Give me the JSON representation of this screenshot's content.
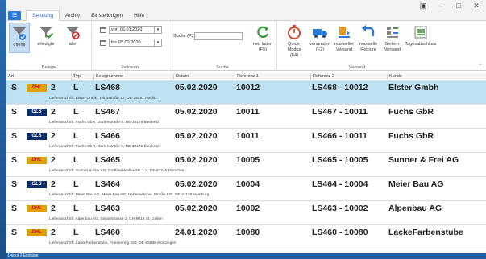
{
  "window": {
    "controls": [
      "▣",
      "–",
      "□",
      "✕"
    ]
  },
  "menu_icon": "☰",
  "tabs": [
    {
      "label": "Sendung",
      "active": true
    },
    {
      "label": "Archiv"
    },
    {
      "label": "Einstellungen"
    },
    {
      "label": "Hilfe"
    }
  ],
  "ribbon": {
    "belege": {
      "label": "Belege",
      "buttons": [
        {
          "label": "offene",
          "icon": "funnel-icon",
          "selected": true
        },
        {
          "label": "erledigte",
          "icon": "funnel-check-icon"
        },
        {
          "label": "alle",
          "icon": "funnel-no-icon"
        }
      ]
    },
    "zeitraum": {
      "label": "Zeitraum",
      "von_label": "von",
      "von_value": "06.01.2020",
      "bis_label": "bis",
      "bis_value": "05.02.2020"
    },
    "suche": {
      "label": "Suche",
      "field_label": "Suche (F3):",
      "value": ""
    },
    "laden": {
      "label_line1": "neu laden",
      "label_line2": "(F5)"
    },
    "versand": {
      "label": "Versand",
      "buttons": [
        {
          "line1": "Quick-Modus",
          "line2": "(F4)",
          "icon": "stopwatch-icon"
        },
        {
          "line1": "versenden",
          "line2": "(F2)",
          "icon": "truck-icon"
        },
        {
          "line1": "manueller",
          "line2": "Versand",
          "icon": "manual-ship-icon"
        },
        {
          "line1": "manuelle",
          "line2": "Retoure",
          "icon": "return-icon"
        },
        {
          "line1": "Seriein-",
          "line2": "Versand",
          "icon": "serial-icon"
        },
        {
          "line1": "Tagesabschluss",
          "line2": "",
          "icon": "day-close-icon"
        }
      ]
    }
  },
  "columns": {
    "art": "Art",
    "typ": "Typ",
    "belegnummer": "Belegnummer",
    "datum": "Datum",
    "ref1": "Referenz 1",
    "ref2": "Referenz 2",
    "kunde": "Kunde"
  },
  "rows": [
    {
      "art": "S",
      "carrier": "DHL",
      "qty": "2",
      "typ": "L",
      "beleg": "LS468",
      "datum": "05.02.2020",
      "ref1": "10012",
      "ref2": "LS468 - 10012",
      "kunde": "Elster Gmbh",
      "anschrift": "Lieferanschrift: Elster Gmbh, Teichstraße 17, DE-39291 Nedlitz",
      "selected": true
    },
    {
      "art": "S",
      "carrier": "GLS",
      "qty": "2",
      "typ": "L",
      "beleg": "LS467",
      "datum": "05.02.2020",
      "ref1": "10011",
      "ref2": "LS467 - 10011",
      "kunde": "Fuchs GbR",
      "anschrift": "Lieferanschrift: Fuchs GbR, Gartenstraße 9, DE-39175 Biederitz"
    },
    {
      "art": "S",
      "carrier": "GLS",
      "qty": "2",
      "typ": "L",
      "beleg": "LS466",
      "datum": "05.02.2020",
      "ref1": "10011",
      "ref2": "LS466 - 10011",
      "kunde": "Fuchs GbR",
      "anschrift": "Lieferanschrift: Fuchs GbR, Gartenstraße 9, DE-39175 Biederitz"
    },
    {
      "art": "S",
      "carrier": "DHL",
      "qty": "2",
      "typ": "L",
      "beleg": "LS465",
      "datum": "05.02.2020",
      "ref1": "10005",
      "ref2": "LS465 - 10005",
      "kunde": "Sunner & Frei AG",
      "anschrift": "Lieferanschrift: Sunner & Frei AG, Gottfried-Keller-Str. 1 a, DE-81245 München"
    },
    {
      "art": "S",
      "carrier": "GLS",
      "qty": "2",
      "typ": "L",
      "beleg": "LS464",
      "datum": "05.02.2020",
      "ref1": "10004",
      "ref2": "LS464 - 10004",
      "kunde": "Meier Bau AG",
      "anschrift": "Lieferanschrift: Meier Bau AG, Meier Bau AG, Hohenwischer Straße 130, DE-21129 Hamburg"
    },
    {
      "art": "S",
      "carrier": "DHL",
      "qty": "2",
      "typ": "L",
      "beleg": "LS463",
      "datum": "05.02.2020",
      "ref1": "10002",
      "ref2": "LS463 - 10002",
      "kunde": "Alpenbau AG",
      "anschrift": "Lieferanschrift: Alpenbau AG, Simonstrasse 2, CH-9016 St. Gallen"
    },
    {
      "art": "S",
      "carrier": "DHL",
      "qty": "2",
      "typ": "L",
      "beleg": "LS460",
      "datum": "24.01.2020",
      "ref1": "10080",
      "ref2": "LS460 - 10080",
      "kunde": "LackeFarbenstube",
      "anschrift": "Lieferanschrift: LackeFarbenstube, Friesenring 158, DE-55569 Monzingen"
    }
  ],
  "statusbar": "Depot 2 Einträge",
  "colors": {
    "accent": "#1a5fa8",
    "selected_row": "#bfe2f3",
    "dhl": "#e0a100",
    "gls": "#0b2d6b"
  }
}
